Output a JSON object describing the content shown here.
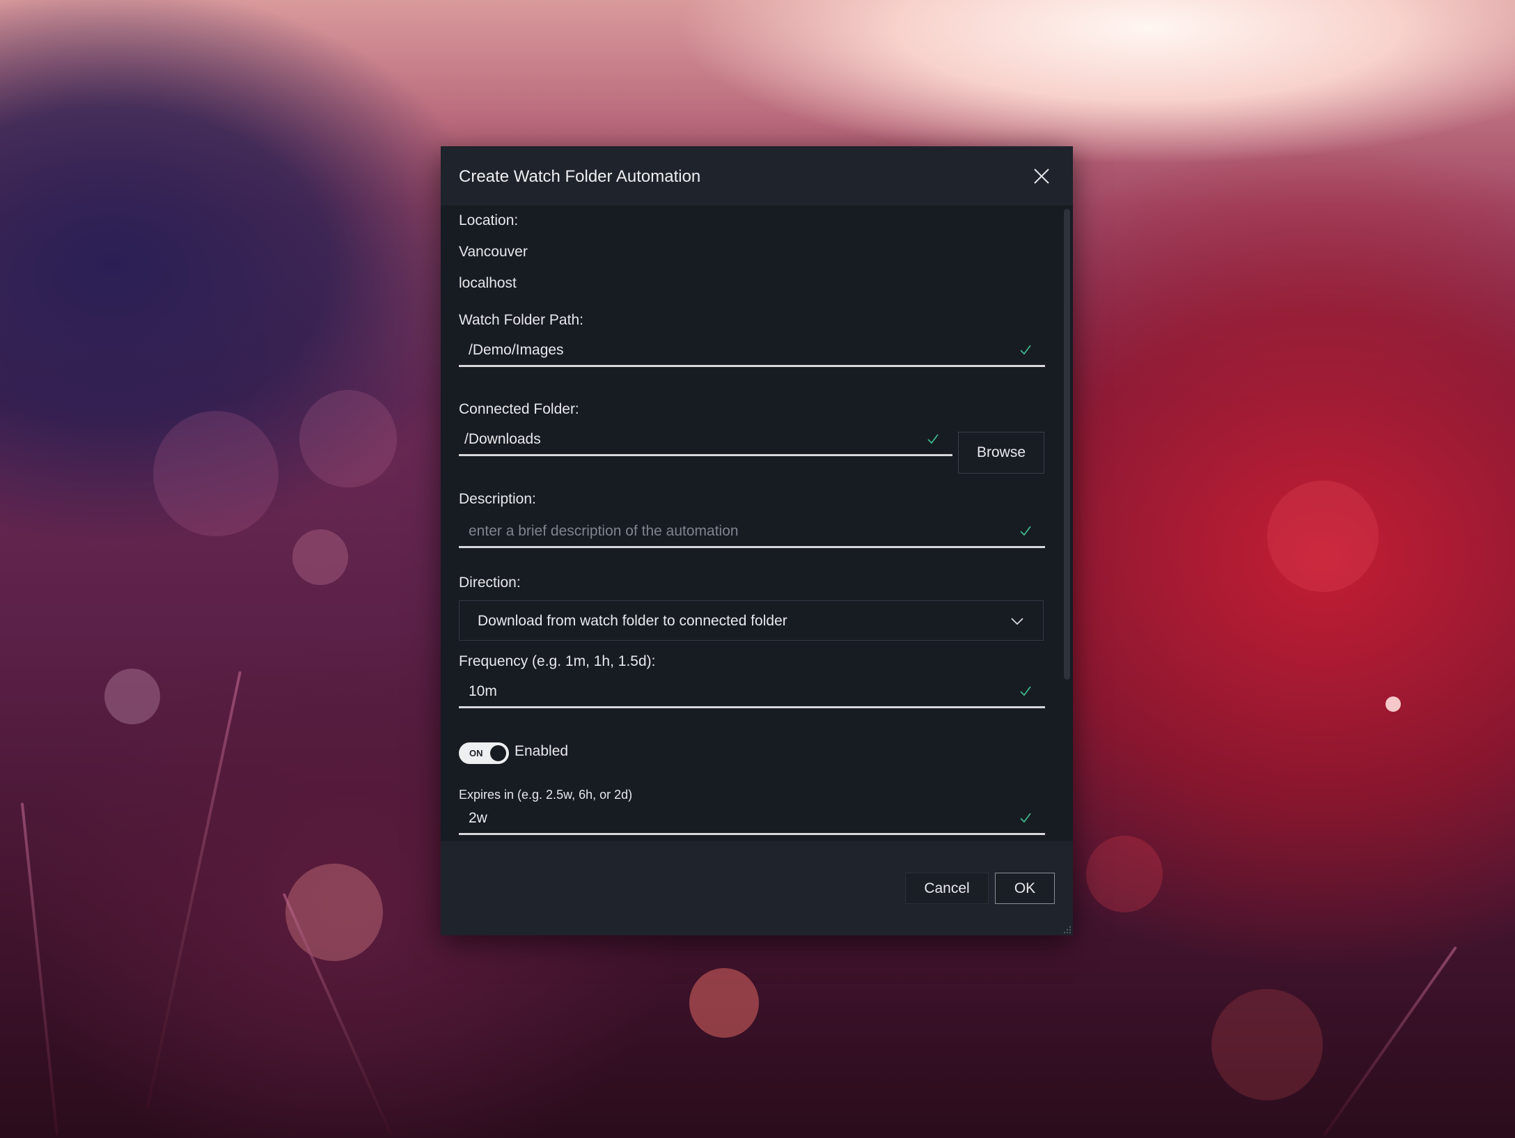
{
  "dialog": {
    "title": "Create Watch Folder Automation"
  },
  "location": {
    "label": "Location:",
    "site": "Vancouver",
    "host": "localhost"
  },
  "watch_folder": {
    "label": "Watch Folder Path:",
    "value": "/Demo/Images"
  },
  "connected_folder": {
    "label": "Connected Folder:",
    "value": "/Downloads",
    "browse_label": "Browse"
  },
  "description": {
    "label": "Description:",
    "value": "",
    "placeholder": "enter a brief description of the automation"
  },
  "direction": {
    "label": "Direction:",
    "selected": "Download from watch folder to connected folder"
  },
  "frequency": {
    "label": "Frequency (e.g. 1m, 1h, 1.5d):",
    "value": "10m"
  },
  "enabled": {
    "toggle_text": "ON",
    "label": "Enabled",
    "state": true
  },
  "expires": {
    "label": "Expires in (e.g. 2.5w, 6h, or 2d)",
    "value": "2w"
  },
  "footer": {
    "cancel_label": "Cancel",
    "ok_label": "OK"
  },
  "colors": {
    "dialog_bg": "#171b22",
    "header_bg": "#1f232b",
    "check_green": "#3fb68b"
  },
  "icons": {
    "close": "close-icon",
    "check": "check-icon",
    "chevron": "chevron-down-icon"
  }
}
